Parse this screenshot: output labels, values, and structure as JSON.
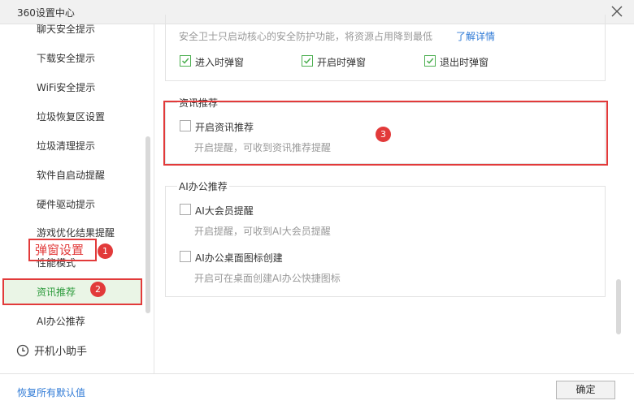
{
  "window": {
    "title": "360设置中心",
    "close_icon": "close-icon"
  },
  "sidebar": {
    "items": [
      {
        "label": "聊天安全提示"
      },
      {
        "label": "下载安全提示"
      },
      {
        "label": "WiFi安全提示"
      },
      {
        "label": "垃圾恢复区设置"
      },
      {
        "label": "垃圾清理提示"
      },
      {
        "label": "软件自启动提醒"
      },
      {
        "label": "硬件驱动提示"
      },
      {
        "label": "游戏优化结果提醒"
      },
      {
        "label": "性能模式"
      },
      {
        "label": "资讯推荐"
      },
      {
        "label": "AI办公推荐"
      }
    ],
    "helper_label": "开机小助手",
    "overlay_label": "弹窗设置"
  },
  "annotations": {
    "badge1": "1",
    "badge2": "2",
    "badge3": "3"
  },
  "main": {
    "top_note": "安全卫士只启动核心的安全防护功能，将资源占用降到最低",
    "top_link": "了解详情",
    "popup_options": [
      {
        "label": "进入时弹窗",
        "checked": true
      },
      {
        "label": "开启时弹窗",
        "checked": true
      },
      {
        "label": "退出时弹窗",
        "checked": true
      }
    ],
    "news_section": {
      "title": "资讯推荐",
      "option": {
        "label": "开启资讯推荐",
        "checked": false
      },
      "desc": "开启提醒，可收到资讯推荐提醒"
    },
    "ai_section": {
      "title": "AI办公推荐",
      "options": [
        {
          "label": "AI大会员提醒",
          "checked": false,
          "desc": "开启提醒，可收到AI大会员提醒"
        },
        {
          "label": "AI办公桌面图标创建",
          "checked": false,
          "desc": "开启可在桌面创建AI办公快捷图标"
        }
      ]
    }
  },
  "footer": {
    "restore_label": "恢复所有默认值",
    "ok_label": "确定"
  },
  "colors": {
    "accent_green": "#2b9a3b",
    "link_blue": "#2f7ad6",
    "annotation_red": "#e23a3a"
  }
}
